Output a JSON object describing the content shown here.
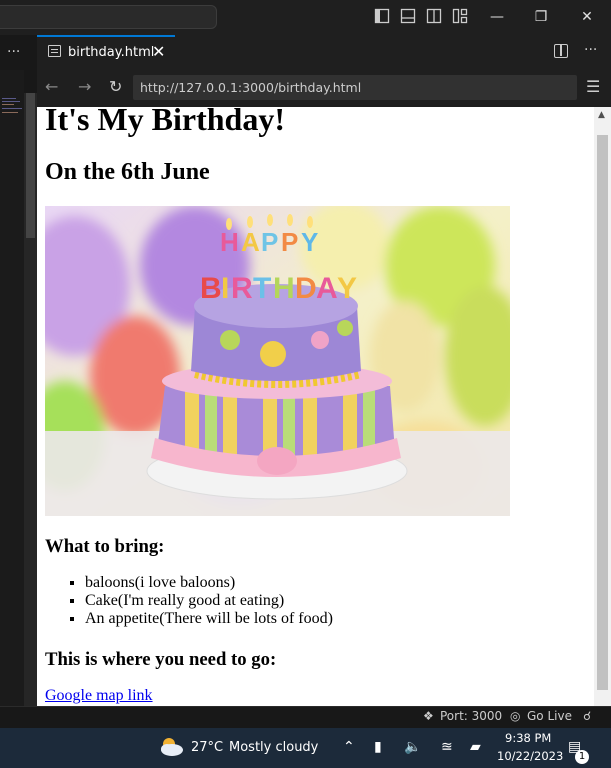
{
  "editor": {
    "tab_label": "birthday.html",
    "more_label": "···"
  },
  "browser": {
    "url": "http://127.0.0.1:3000/birthday.html"
  },
  "page": {
    "title": "It's My Birthday!",
    "date_heading": "On the 6th June",
    "cake_banner": "HAPPY BIRTHDAY",
    "bring_heading": "What to bring:",
    "bring_items": [
      "baloons(i love baloons)",
      "Cake(I'm really good at eating)",
      "An appetite(There will be lots of food)"
    ],
    "where_heading": "This is where you need to go:",
    "map_link": "Google map link"
  },
  "status_bar": {
    "port": "Port: 3000",
    "go_live": "Go Live"
  },
  "taskbar": {
    "temperature": "27°C",
    "weather": "Mostly cloudy",
    "time": "9:38 PM",
    "date": "10/22/2023",
    "notification_count": "1"
  },
  "colors": {
    "accent": "#0078d4",
    "link": "#0000ee"
  }
}
